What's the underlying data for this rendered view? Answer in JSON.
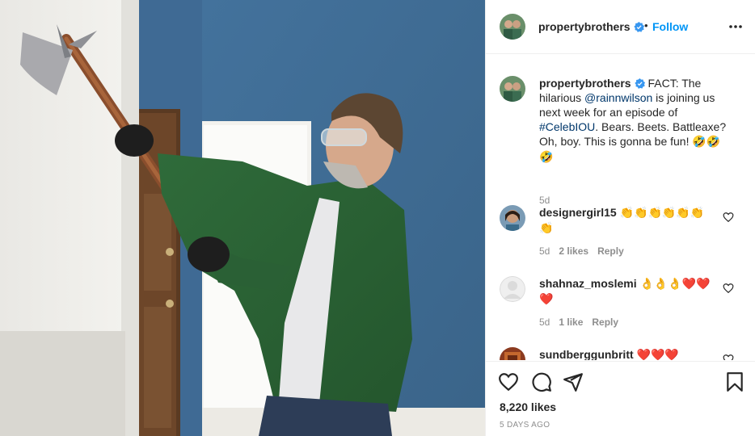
{
  "post": {
    "username": "propertybrothers",
    "dot": "•",
    "follow_label": "Follow",
    "caption_username": "propertybrothers",
    "caption_pre": " FACT: The hilarious ",
    "caption_mention": "@rainnwilson",
    "caption_mid": " is joining us next week for an episode of ",
    "caption_hashtag": "#CelebIOU",
    "caption_post": ". Bears. Beets. Battleaxe? Oh, boy. This is gonna be fun! ",
    "caption_emoji": "🤣🤣🤣",
    "caption_time": "5d",
    "likes": "8,220 likes",
    "posted": "5 DAYS AGO"
  },
  "comments": [
    {
      "username": "designergirl15",
      "text": "👏👏👏👏👏👏👏",
      "time": "5d",
      "likes": "2 likes",
      "reply": "Reply"
    },
    {
      "username": "shahnaz_moslemi",
      "text": "👌👌👌❤️❤️❤️",
      "time": "5d",
      "likes": "1 like",
      "reply": "Reply"
    },
    {
      "username": "sundberggunbritt",
      "text": "❤️❤️❤️",
      "time": "",
      "likes": "",
      "reply": ""
    }
  ],
  "icons": [
    "verified-badge-icon",
    "more-options-icon",
    "heart-icon",
    "comment-icon",
    "share-icon",
    "bookmark-icon"
  ],
  "colors": {
    "accent": "#0095f6",
    "verified": "#3897f0",
    "link": "#00376b",
    "muted": "#8e8e8e"
  }
}
